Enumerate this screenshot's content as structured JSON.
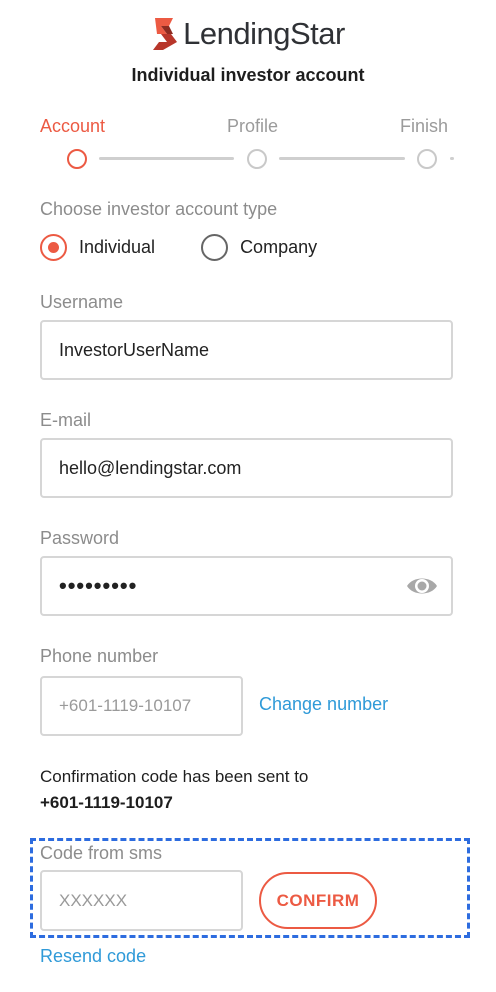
{
  "brand": {
    "name": "LendingStar",
    "logo_icon": "lendingstar-logo-icon",
    "accent_color": "#ec5a43",
    "link_color": "#2f9ad8"
  },
  "page": {
    "title": "Individual investor account"
  },
  "stepper": {
    "steps": [
      {
        "label": "Account",
        "state": "active"
      },
      {
        "label": "Profile",
        "state": "pending"
      },
      {
        "label": "Finish",
        "state": "pending"
      }
    ]
  },
  "account_type": {
    "label": "Choose investor account type",
    "options": [
      {
        "label": "Individual",
        "checked": true
      },
      {
        "label": "Company",
        "checked": false
      }
    ]
  },
  "username": {
    "label": "Username",
    "value": "InvestorUserName"
  },
  "email": {
    "label": "E-mail",
    "value": "hello@lendingstar.com"
  },
  "password": {
    "label": "Password",
    "value": "•••••••••",
    "toggle_icon": "eye-icon"
  },
  "phone": {
    "label": "Phone number",
    "placeholder": "+601-1119-10107",
    "change_link": "Change number"
  },
  "confirmation": {
    "message": "Confirmation code has been sent to",
    "phone": "+601-1119-10107"
  },
  "sms_code": {
    "label": "Code from sms",
    "placeholder": "XXXXXX",
    "confirm_label": "CONFIRM",
    "resend_link": "Resend code"
  }
}
